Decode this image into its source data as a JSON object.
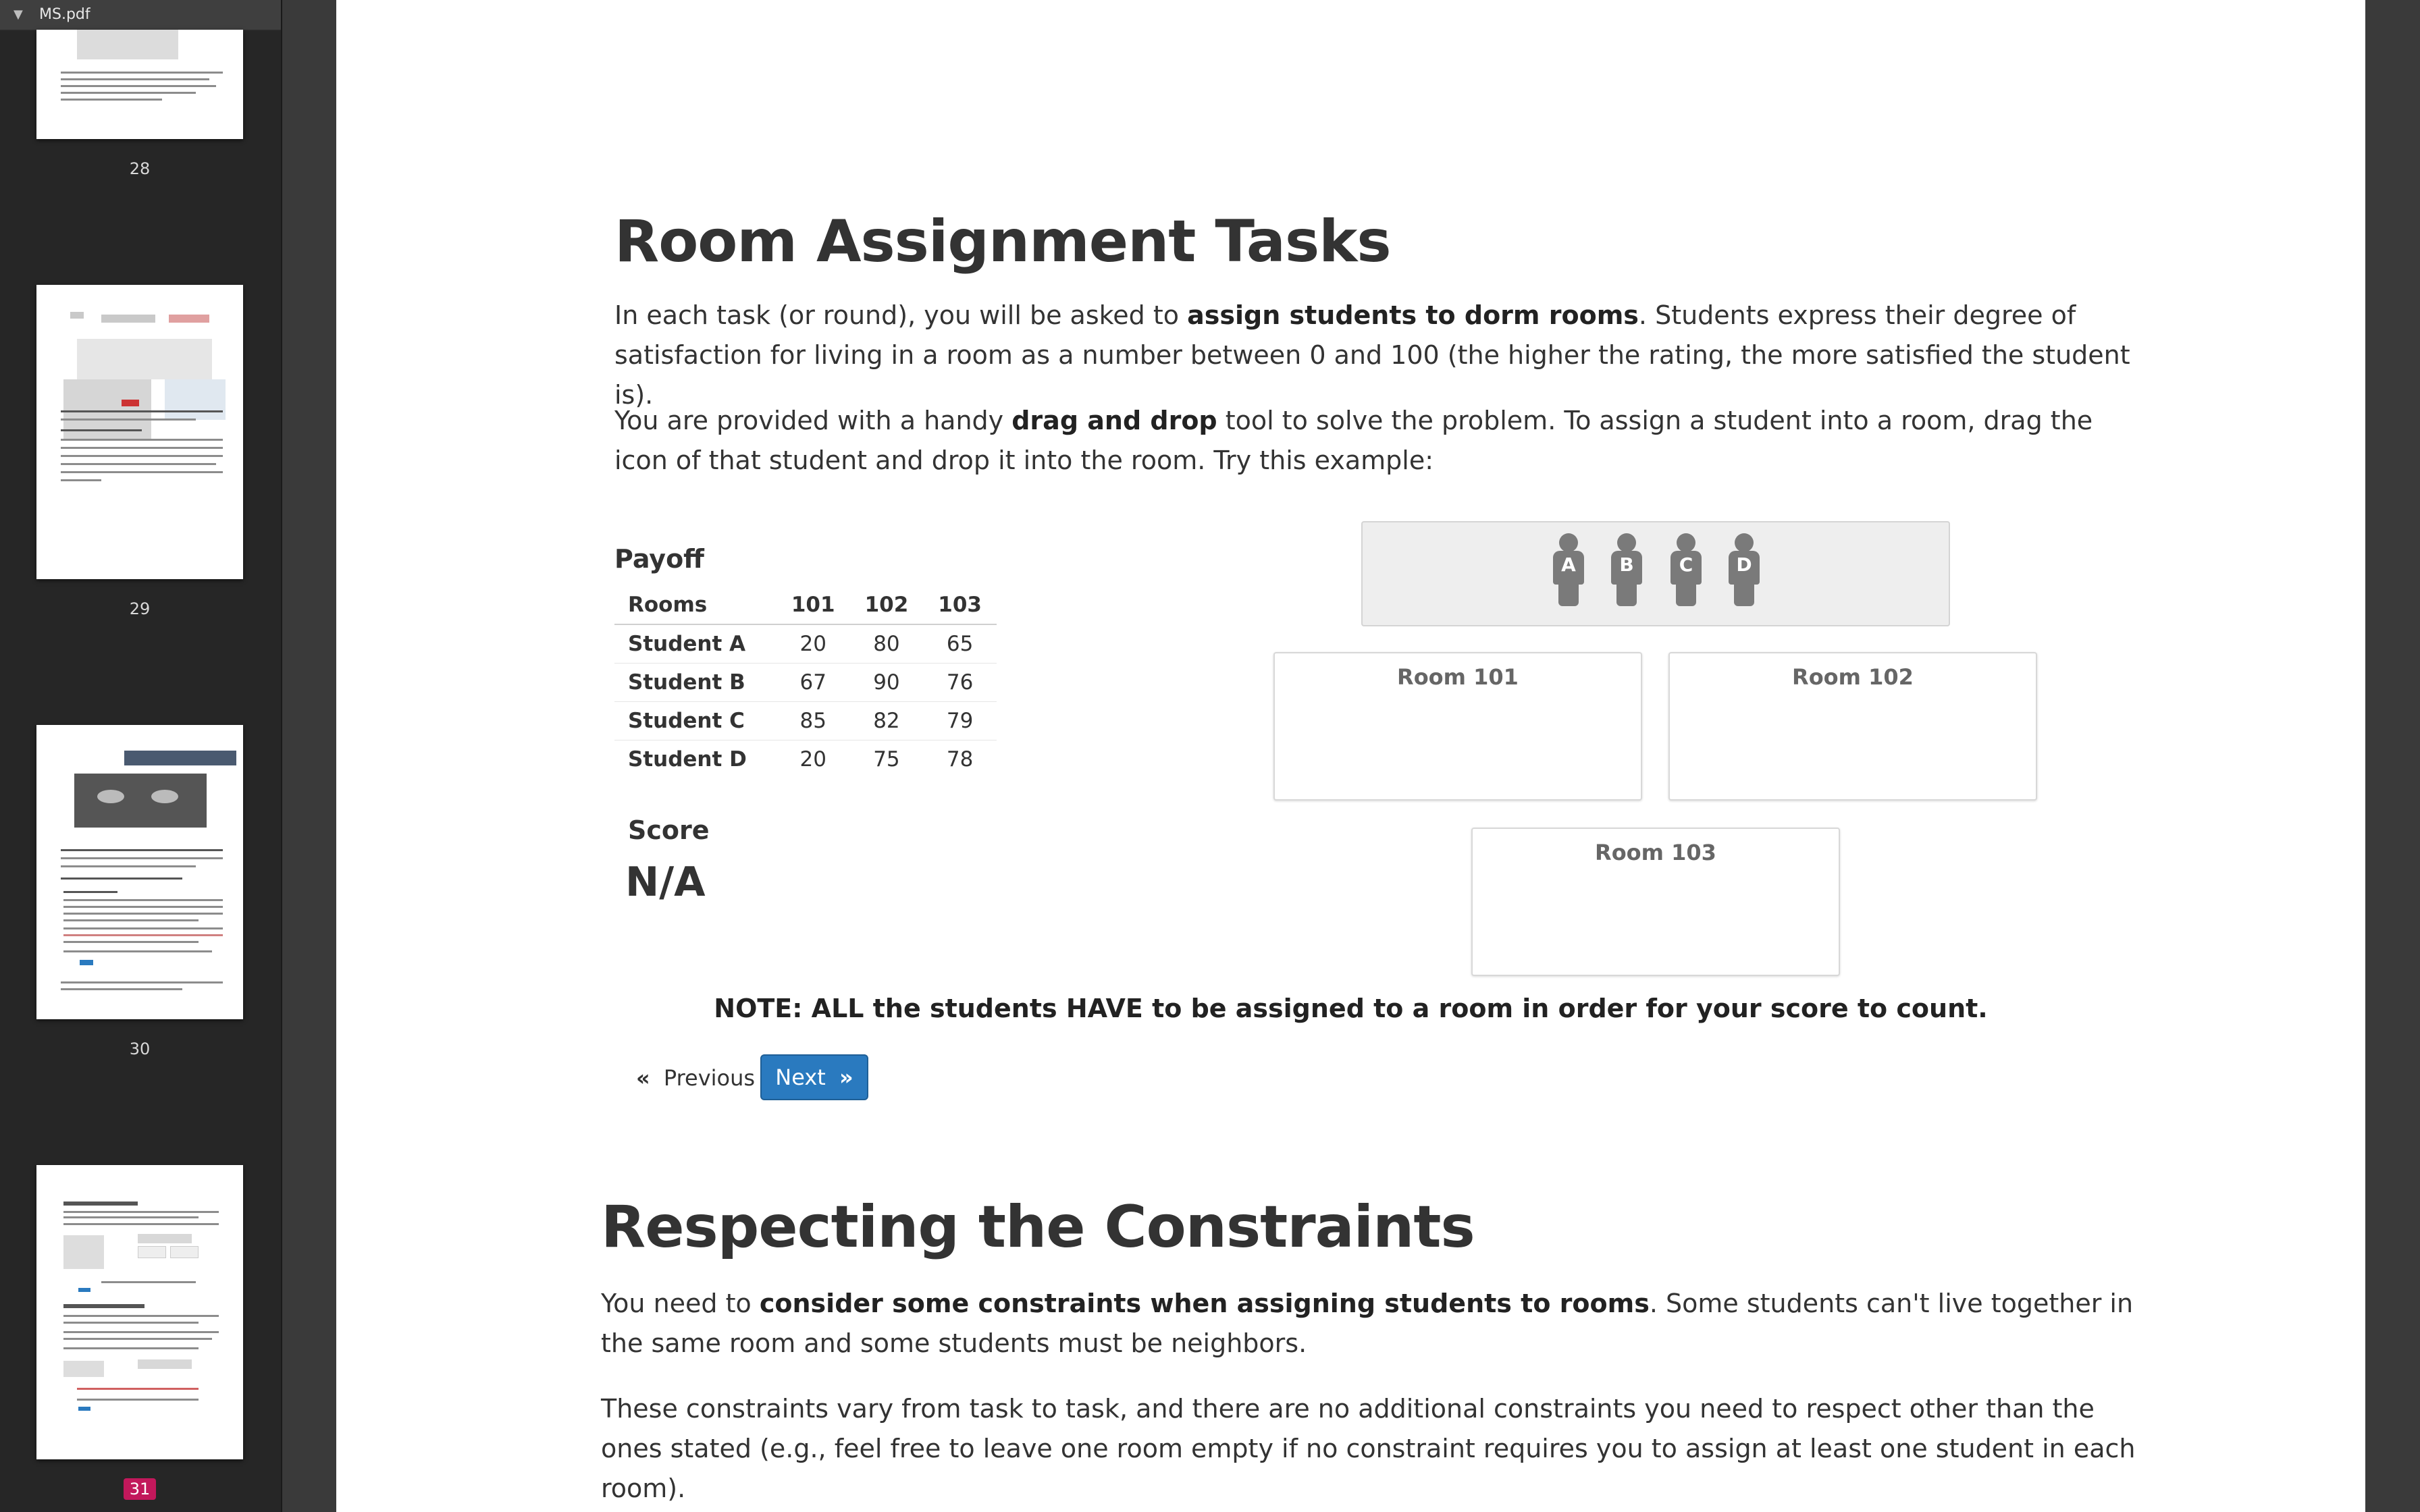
{
  "sidebar": {
    "file_name": "MS.pdf",
    "pages": [
      {
        "number": "28",
        "active": false
      },
      {
        "number": "29",
        "active": false
      },
      {
        "number": "30",
        "active": false
      },
      {
        "number": "31",
        "active": true
      }
    ]
  },
  "section1": {
    "title": "Room Assignment Tasks",
    "p1_a": "In each task (or round), you will be asked to ",
    "p1_b": "assign students to dorm rooms",
    "p1_c": ". Students express their degree of satisfaction for living in a room as a number between 0 and 100 (the higher the rating, the more satisfied the student is).",
    "p2_a": "You are provided with a handy ",
    "p2_b": "drag and drop",
    "p2_c": " tool to solve the problem. To assign a student into a room, drag the icon of that student and drop it into the room. Try this example:"
  },
  "payoff": {
    "title": "Payoff",
    "headers": [
      "Rooms",
      "101",
      "102",
      "103"
    ],
    "rows": [
      [
        "Student A",
        "20",
        "80",
        "65"
      ],
      [
        "Student B",
        "67",
        "90",
        "76"
      ],
      [
        "Student C",
        "85",
        "82",
        "79"
      ],
      [
        "Student D",
        "20",
        "75",
        "78"
      ]
    ]
  },
  "score": {
    "label": "Score",
    "value": "N/A"
  },
  "students": [
    "A",
    "B",
    "C",
    "D"
  ],
  "rooms": [
    "Room 101",
    "Room 102",
    "Room 103"
  ],
  "note": "NOTE: ALL the students HAVE to be assigned to a room in order for your score to count.",
  "nav": {
    "previous": "Previous",
    "next": "Next"
  },
  "section2": {
    "title": "Respecting the Constraints",
    "p1_a": "You need to ",
    "p1_b": "consider some constraints when assigning students to rooms",
    "p1_c": ". Some students can't live together in the same room and some students must be neighbors.",
    "p2": "These constraints vary from task to task, and there are no additional constraints you need to respect other than the ones stated (e.g., feel free to leave one room empty if no constraint requires you to assign at least one student in each room)."
  }
}
